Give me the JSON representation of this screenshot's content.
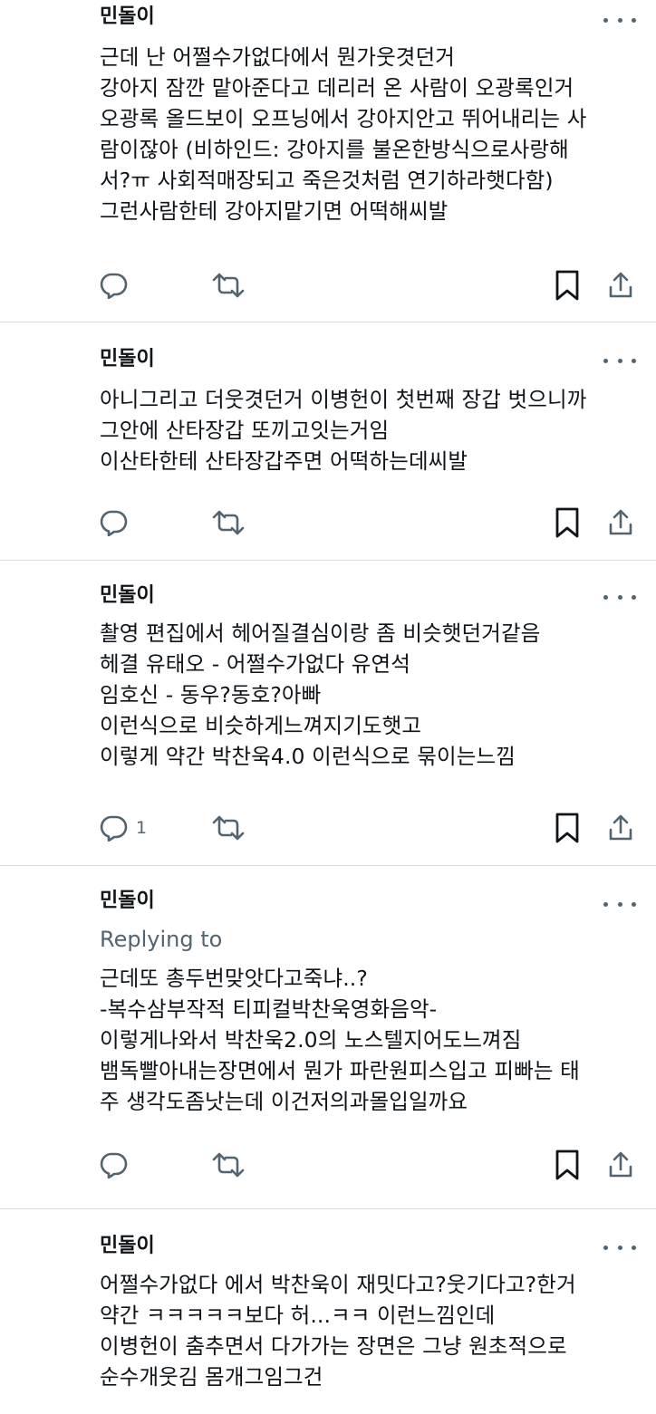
{
  "posts": [
    {
      "author": "민돌이",
      "replying_to": "",
      "lines": [
        "근데 난 어쩔수가없다에서 뭔가웃겻던거",
        "강아지 잠깐 맡아준다고 데리러 온 사람이 오광록인거",
        "오광록 올드보이 오프닝에서 강아지안고 뛰어내리는 사",
        "람이잖아 (비하인드: 강아지를 불온한방식으로사랑해",
        "서?ㅠ 사회적매장되고 죽은것처럼 연기하라햇다함)",
        "그런사람한테 강아지맡기면 어떡해씨발"
      ],
      "reply_count": ""
    },
    {
      "author": "민돌이",
      "replying_to": "",
      "lines": [
        "아니그리고 더웃겻던거 이병헌이 첫번째 장갑 벗으니까",
        "그안에 산타장갑 또끼고잇는거임",
        "이산타한테 산타장갑주면 어떡하는데씨발"
      ],
      "reply_count": ""
    },
    {
      "author": "민돌이",
      "replying_to": "",
      "lines": [
        "촬영 편집에서 헤어질결심이랑 좀 비슷햇던거같음",
        "헤결 유태오 - 어쩔수가없다 유연석",
        "임호신 - 동우?동호?아빠",
        "이런식으로 비슷하게느껴지기도햇고",
        "이렇게 약간 박찬욱4.0 이런식으로 묶이는느낌"
      ],
      "reply_count": "1"
    },
    {
      "author": "민돌이",
      "replying_to": "Replying to",
      "lines": [
        "근데또 총두번맞앗다고죽냐..?",
        "-복수삼부작적 티피컬박찬욱영화음악-",
        "이렇게나와서 박찬욱2.0의 노스텔지어도느껴짐",
        "뱀독빨아내는장면에서 뭔가 파란원피스입고 피빠는 태",
        "주 생각도좀낫는데 이건저의과몰입일까요"
      ],
      "reply_count": ""
    },
    {
      "author": "민돌이",
      "replying_to": "",
      "lines": [
        "어쩔수가없다 에서 박찬욱이 재밋다고?웃기다고?한거",
        "약간 ㅋㅋㅋㅋㅋ보다 허...ㅋㅋ 이런느낌인데",
        "이병헌이 춤추면서 다가가는 장면은 그냥 원초적으로",
        "순수개웃김 몸개그임그건"
      ],
      "reply_count": ""
    }
  ],
  "icons": {
    "more": "more-options-icon",
    "reply": "reply-icon",
    "repost": "repost-icon",
    "bookmark": "bookmark-icon",
    "share": "share-icon"
  },
  "colors": {
    "text": "#0f1419",
    "secondary": "#536471",
    "divider": "#d9dde1",
    "background": "#ffffff"
  }
}
